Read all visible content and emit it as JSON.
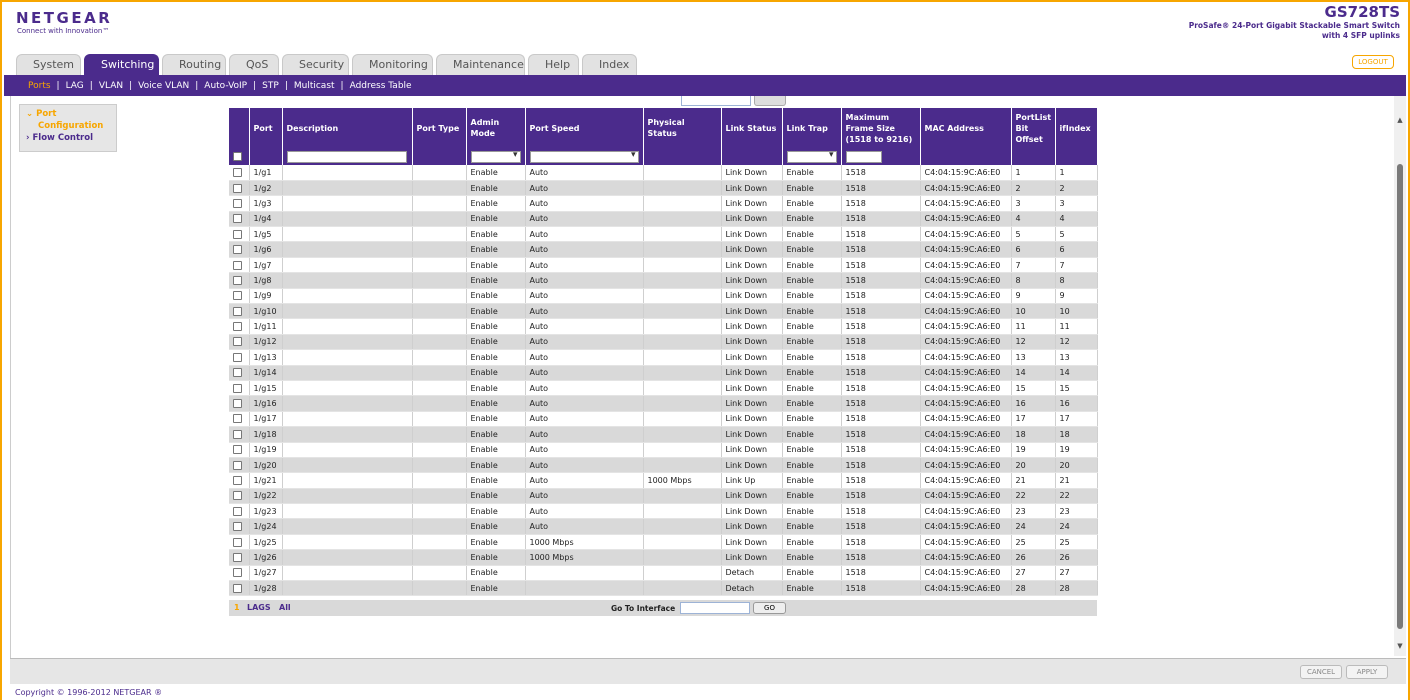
{
  "brand": {
    "logo": "NETGEAR",
    "tagline": "Connect with Innovation™",
    "model": "GS728TS",
    "model_desc_1": "ProSafe® 24-Port Gigabit Stackable Smart Switch",
    "model_desc_2": "with 4 SFP uplinks"
  },
  "tabs": [
    "System",
    "Switching",
    "Routing",
    "QoS",
    "Security",
    "Monitoring",
    "Maintenance",
    "Help",
    "Index"
  ],
  "active_tab": "Switching",
  "logout_label": "LOGOUT",
  "subnav": [
    "Ports",
    "LAG",
    "VLAN",
    "Voice VLAN",
    "Auto-VoIP",
    "STP",
    "Multicast",
    "Address Table"
  ],
  "leftnav": {
    "item1_a": "Port",
    "item1_b": "Configuration",
    "item2": "Flow Control"
  },
  "table": {
    "headers": [
      "Port",
      "Description",
      "Port Type",
      "Admin Mode",
      "Port Speed",
      "Physical Status",
      "Link Status",
      "Link Trap",
      "Maximum Frame Size (1518 to 9216)",
      "MAC Address",
      "PortList Bit Offset",
      "ifIndex"
    ],
    "rows": [
      [
        "1/g1",
        "",
        "",
        "Enable",
        "Auto",
        "",
        "Link Down",
        "Enable",
        "1518",
        "C4:04:15:9C:A6:E0",
        "1",
        "1"
      ],
      [
        "1/g2",
        "",
        "",
        "Enable",
        "Auto",
        "",
        "Link Down",
        "Enable",
        "1518",
        "C4:04:15:9C:A6:E0",
        "2",
        "2"
      ],
      [
        "1/g3",
        "",
        "",
        "Enable",
        "Auto",
        "",
        "Link Down",
        "Enable",
        "1518",
        "C4:04:15:9C:A6:E0",
        "3",
        "3"
      ],
      [
        "1/g4",
        "",
        "",
        "Enable",
        "Auto",
        "",
        "Link Down",
        "Enable",
        "1518",
        "C4:04:15:9C:A6:E0",
        "4",
        "4"
      ],
      [
        "1/g5",
        "",
        "",
        "Enable",
        "Auto",
        "",
        "Link Down",
        "Enable",
        "1518",
        "C4:04:15:9C:A6:E0",
        "5",
        "5"
      ],
      [
        "1/g6",
        "",
        "",
        "Enable",
        "Auto",
        "",
        "Link Down",
        "Enable",
        "1518",
        "C4:04:15:9C:A6:E0",
        "6",
        "6"
      ],
      [
        "1/g7",
        "",
        "",
        "Enable",
        "Auto",
        "",
        "Link Down",
        "Enable",
        "1518",
        "C4:04:15:9C:A6:E0",
        "7",
        "7"
      ],
      [
        "1/g8",
        "",
        "",
        "Enable",
        "Auto",
        "",
        "Link Down",
        "Enable",
        "1518",
        "C4:04:15:9C:A6:E0",
        "8",
        "8"
      ],
      [
        "1/g9",
        "",
        "",
        "Enable",
        "Auto",
        "",
        "Link Down",
        "Enable",
        "1518",
        "C4:04:15:9C:A6:E0",
        "9",
        "9"
      ],
      [
        "1/g10",
        "",
        "",
        "Enable",
        "Auto",
        "",
        "Link Down",
        "Enable",
        "1518",
        "C4:04:15:9C:A6:E0",
        "10",
        "10"
      ],
      [
        "1/g11",
        "",
        "",
        "Enable",
        "Auto",
        "",
        "Link Down",
        "Enable",
        "1518",
        "C4:04:15:9C:A6:E0",
        "11",
        "11"
      ],
      [
        "1/g12",
        "",
        "",
        "Enable",
        "Auto",
        "",
        "Link Down",
        "Enable",
        "1518",
        "C4:04:15:9C:A6:E0",
        "12",
        "12"
      ],
      [
        "1/g13",
        "",
        "",
        "Enable",
        "Auto",
        "",
        "Link Down",
        "Enable",
        "1518",
        "C4:04:15:9C:A6:E0",
        "13",
        "13"
      ],
      [
        "1/g14",
        "",
        "",
        "Enable",
        "Auto",
        "",
        "Link Down",
        "Enable",
        "1518",
        "C4:04:15:9C:A6:E0",
        "14",
        "14"
      ],
      [
        "1/g15",
        "",
        "",
        "Enable",
        "Auto",
        "",
        "Link Down",
        "Enable",
        "1518",
        "C4:04:15:9C:A6:E0",
        "15",
        "15"
      ],
      [
        "1/g16",
        "",
        "",
        "Enable",
        "Auto",
        "",
        "Link Down",
        "Enable",
        "1518",
        "C4:04:15:9C:A6:E0",
        "16",
        "16"
      ],
      [
        "1/g17",
        "",
        "",
        "Enable",
        "Auto",
        "",
        "Link Down",
        "Enable",
        "1518",
        "C4:04:15:9C:A6:E0",
        "17",
        "17"
      ],
      [
        "1/g18",
        "",
        "",
        "Enable",
        "Auto",
        "",
        "Link Down",
        "Enable",
        "1518",
        "C4:04:15:9C:A6:E0",
        "18",
        "18"
      ],
      [
        "1/g19",
        "",
        "",
        "Enable",
        "Auto",
        "",
        "Link Down",
        "Enable",
        "1518",
        "C4:04:15:9C:A6:E0",
        "19",
        "19"
      ],
      [
        "1/g20",
        "",
        "",
        "Enable",
        "Auto",
        "",
        "Link Down",
        "Enable",
        "1518",
        "C4:04:15:9C:A6:E0",
        "20",
        "20"
      ],
      [
        "1/g21",
        "",
        "",
        "Enable",
        "Auto",
        "1000 Mbps",
        "Link Up",
        "Enable",
        "1518",
        "C4:04:15:9C:A6:E0",
        "21",
        "21"
      ],
      [
        "1/g22",
        "",
        "",
        "Enable",
        "Auto",
        "",
        "Link Down",
        "Enable",
        "1518",
        "C4:04:15:9C:A6:E0",
        "22",
        "22"
      ],
      [
        "1/g23",
        "",
        "",
        "Enable",
        "Auto",
        "",
        "Link Down",
        "Enable",
        "1518",
        "C4:04:15:9C:A6:E0",
        "23",
        "23"
      ],
      [
        "1/g24",
        "",
        "",
        "Enable",
        "Auto",
        "",
        "Link Down",
        "Enable",
        "1518",
        "C4:04:15:9C:A6:E0",
        "24",
        "24"
      ],
      [
        "1/g25",
        "",
        "",
        "Enable",
        "1000 Mbps",
        "",
        "Link Down",
        "Enable",
        "1518",
        "C4:04:15:9C:A6:E0",
        "25",
        "25"
      ],
      [
        "1/g26",
        "",
        "",
        "Enable",
        "1000 Mbps",
        "",
        "Link Down",
        "Enable",
        "1518",
        "C4:04:15:9C:A6:E0",
        "26",
        "26"
      ],
      [
        "1/g27",
        "",
        "",
        "Enable",
        "",
        "",
        "Detach",
        "Enable",
        "1518",
        "C4:04:15:9C:A6:E0",
        "27",
        "27"
      ],
      [
        "1/g28",
        "",
        "",
        "Enable",
        "",
        "",
        "Detach",
        "Enable",
        "1518",
        "C4:04:15:9C:A6:E0",
        "28",
        "28"
      ]
    ]
  },
  "pager": {
    "page": "1",
    "lags": "LAGS",
    "all": "All",
    "goto_label": "Go To Interface",
    "go_label": "GO"
  },
  "buttons": {
    "cancel": "CANCEL",
    "apply": "APPLY"
  },
  "copyright": "Copyright © 1996-2012 NETGEAR ®",
  "colors": {
    "purple": "#4b2b8c",
    "orange": "#f7a600"
  }
}
